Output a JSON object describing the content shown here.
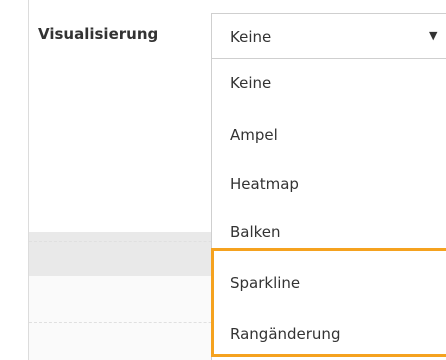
{
  "visualization": {
    "label": "Visualisierung",
    "selected_value": "Keine",
    "options": [
      "Keine",
      "Ampel",
      "Heatmap",
      "Balken",
      "Sparkline",
      "Rangänderung"
    ]
  },
  "colors": {
    "highlight": "#f5a21f",
    "text": "#333333",
    "border": "#cfcfcf"
  },
  "icons": {
    "caret": "caret-down-icon"
  }
}
